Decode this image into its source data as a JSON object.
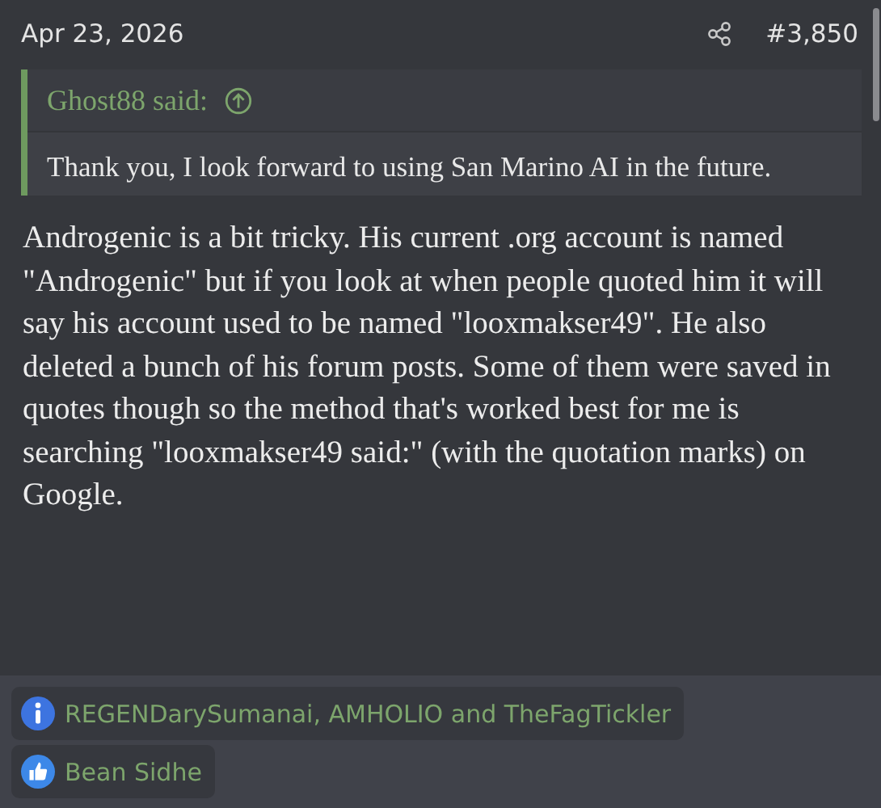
{
  "post": {
    "date": "Apr 23, 2026",
    "number": "#3,850"
  },
  "quote": {
    "author": "Ghost88 said:",
    "text": "Thank you, I look forward to using San Marino AI in the future."
  },
  "body": "Androgenic is a bit tricky. His current .org account is named \"Androgenic\" but if you look at when people quoted him it will say his account used to be named \"looxmakser49\". He also deleted a bunch of his forum posts. Some of them were saved in quotes though so the method that's worked best for me is searching \"looxmakser49 said:\" (with the quotation marks) on Google.",
  "reactions": [
    {
      "kind": "informative",
      "users": "REGENDarySumanai, AMHOLIO and TheFagTickler"
    },
    {
      "kind": "like",
      "users": "Bean Sidhe"
    }
  ]
}
